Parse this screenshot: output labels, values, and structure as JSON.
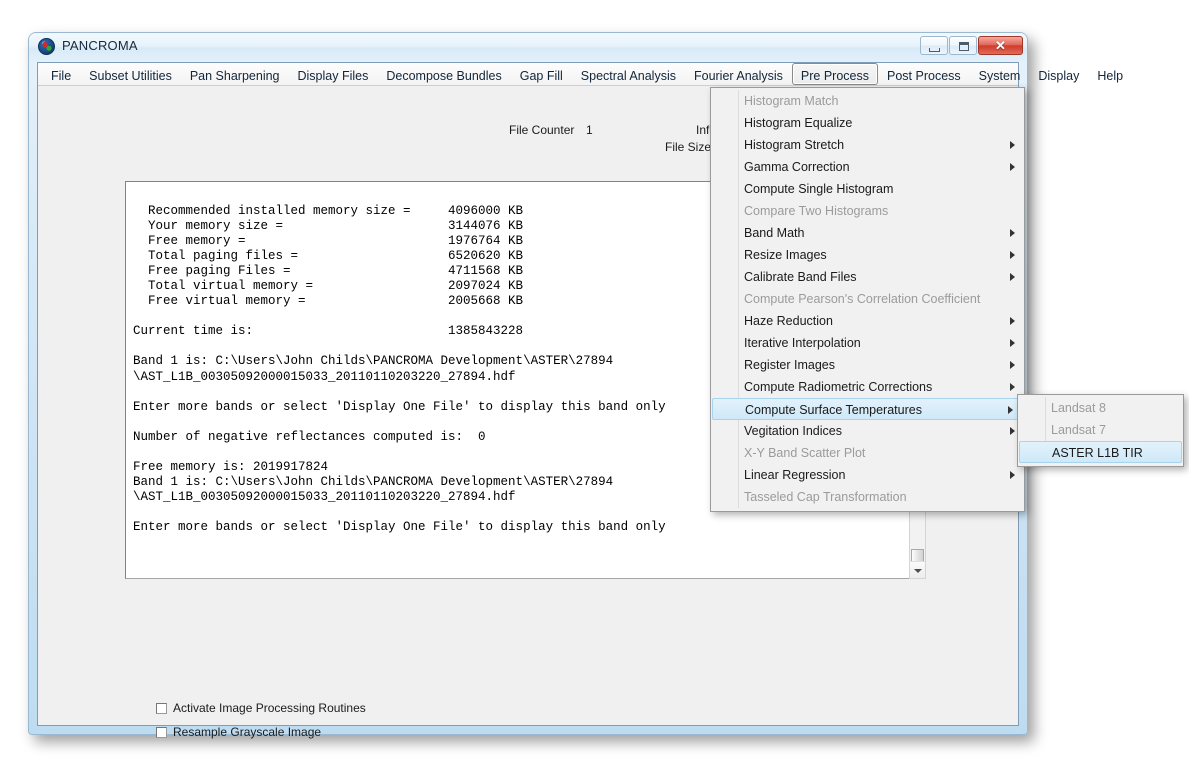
{
  "window": {
    "title": "PANCROMA",
    "icon": "globe-icon",
    "caption_buttons": {
      "minimize": "minimize-icon",
      "maximize": "maximize-icon",
      "close": "✕"
    }
  },
  "menubar": {
    "items": [
      {
        "label": "File",
        "active": false
      },
      {
        "label": "Subset Utilities",
        "active": false
      },
      {
        "label": "Pan Sharpening",
        "active": false
      },
      {
        "label": "Display Files",
        "active": false
      },
      {
        "label": "Decompose Bundles",
        "active": false
      },
      {
        "label": "Gap Fill",
        "active": false
      },
      {
        "label": "Spectral Analysis",
        "active": false
      },
      {
        "label": "Fourier Analysis",
        "active": false
      },
      {
        "label": "Pre Process",
        "active": true
      },
      {
        "label": "Post Process",
        "active": false
      },
      {
        "label": "System",
        "active": false
      },
      {
        "label": "Display",
        "active": false
      },
      {
        "label": "Help",
        "active": false
      }
    ]
  },
  "info": {
    "file_counter_label": "File Counter",
    "file_counter_value": "1",
    "info_label": "Info",
    "file_size_label": "File Size",
    "file_size_value": ""
  },
  "console": {
    "text": "  Recommended installed memory size =     4096000 KB\n  Your memory size =                      3144076 KB\n  Free memory =                           1976764 KB\n  Total paging files =                    6520620 KB\n  Free paging Files =                     4711568 KB\n  Total virtual memory =                  2097024 KB\n  Free virtual memory =                   2005668 KB\n\nCurrent time is:                          1385843228\n\nBand 1 is: C:\\Users\\John Childs\\PANCROMA Development\\ASTER\\27894\n\\AST_L1B_00305092000015033_20110110203220_27894.hdf\n\nEnter more bands or select 'Display One File' to display this band only\n\nNumber of negative reflectances computed is:  0\n\nFree memory is: 2019917824\nBand 1 is: C:\\Users\\John Childs\\PANCROMA Development\\ASTER\\27894\n\\AST_L1B_00305092000015033_20110110203220_27894.hdf\n\nEnter more bands or select 'Display One File' to display this band only"
  },
  "checkboxes": [
    {
      "label": "Activate Image Processing Routines",
      "checked": false
    },
    {
      "label": "Resample Grayscale Image",
      "checked": false
    }
  ],
  "dropdown": {
    "owner": "Pre Process",
    "items": [
      {
        "label": "Histogram Match",
        "disabled": true,
        "submenu": false,
        "selected": false
      },
      {
        "label": "Histogram Equalize",
        "disabled": false,
        "submenu": false,
        "selected": false
      },
      {
        "label": "Histogram Stretch",
        "disabled": false,
        "submenu": true,
        "selected": false
      },
      {
        "label": "Gamma Correction",
        "disabled": false,
        "submenu": true,
        "selected": false
      },
      {
        "label": "Compute Single Histogram",
        "disabled": false,
        "submenu": false,
        "selected": false
      },
      {
        "label": "Compare Two Histograms",
        "disabled": true,
        "submenu": false,
        "selected": false
      },
      {
        "label": "Band Math",
        "disabled": false,
        "submenu": true,
        "selected": false
      },
      {
        "label": "Resize Images",
        "disabled": false,
        "submenu": true,
        "selected": false
      },
      {
        "label": "Calibrate Band Files",
        "disabled": false,
        "submenu": true,
        "selected": false
      },
      {
        "label": "Compute Pearson's Correlation Coefficient",
        "disabled": true,
        "submenu": false,
        "selected": false
      },
      {
        "label": "Haze Reduction",
        "disabled": false,
        "submenu": true,
        "selected": false
      },
      {
        "label": "Iterative Interpolation",
        "disabled": false,
        "submenu": true,
        "selected": false
      },
      {
        "label": "Register Images",
        "disabled": false,
        "submenu": true,
        "selected": false
      },
      {
        "label": "Compute Radiometric Corrections",
        "disabled": false,
        "submenu": true,
        "selected": false
      },
      {
        "label": "Compute Surface Temperatures",
        "disabled": false,
        "submenu": true,
        "selected": true
      },
      {
        "label": "Vegitation Indices",
        "disabled": false,
        "submenu": true,
        "selected": false
      },
      {
        "label": "X-Y Band  Scatter Plot",
        "disabled": true,
        "submenu": false,
        "selected": false
      },
      {
        "label": "Linear Regression",
        "disabled": false,
        "submenu": true,
        "selected": false
      },
      {
        "label": "Tasseled Cap Transformation",
        "disabled": true,
        "submenu": false,
        "selected": false
      }
    ]
  },
  "submenu": {
    "owner": "Compute Surface Temperatures",
    "items": [
      {
        "label": "Landsat 8",
        "disabled": true,
        "selected": false
      },
      {
        "label": "Landsat 7",
        "disabled": true,
        "selected": false
      },
      {
        "label": "ASTER L1B TIR",
        "disabled": false,
        "selected": true
      }
    ]
  },
  "colors": {
    "highlight": "#cfe8f8",
    "highlight_border": "#a8d4ee",
    "disabled_text": "#9b9b9b",
    "client_bg": "#f0f0f0",
    "frame": "#bedcf1"
  }
}
